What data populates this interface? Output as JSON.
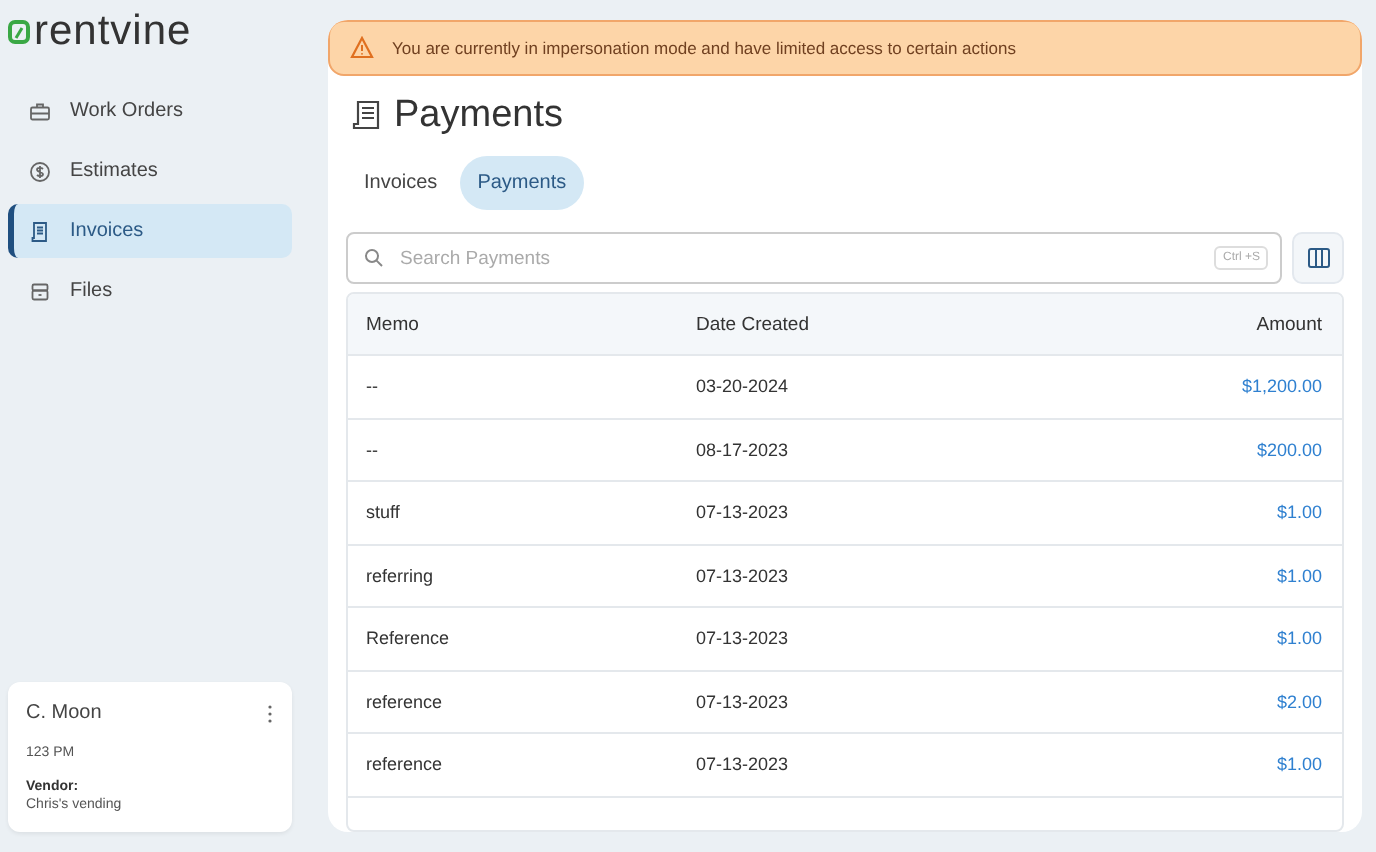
{
  "sidebar": {
    "logo": "rentvine",
    "items": [
      {
        "label": "Work Orders",
        "selected": false
      },
      {
        "label": "Estimates",
        "selected": false
      },
      {
        "label": "Invoices",
        "selected": true
      },
      {
        "label": "Files",
        "selected": false
      }
    ],
    "user_card": {
      "name": "C. Moon",
      "time": "123 PM",
      "vendor_label": "Vendor:",
      "vendor": "Chris's vending"
    }
  },
  "banner": {
    "text": "You are currently in impersonation mode and have limited access to certain actions"
  },
  "page": {
    "title": "Payments",
    "tabs": [
      {
        "label": "Invoices",
        "selected": false
      },
      {
        "label": "Payments",
        "selected": true
      }
    ],
    "search": {
      "placeholder": "Search Payments",
      "shortcut": "Ctrl +S"
    },
    "table": {
      "columns": [
        "Memo",
        "Date Created",
        "Amount"
      ],
      "rows": [
        [
          "--",
          "03-20-2024",
          "$1,200.00"
        ],
        [
          "--",
          "08-17-2023",
          "$200.00"
        ],
        [
          "stuff",
          "07-13-2023",
          "$1.00"
        ],
        [
          "referring",
          "07-13-2023",
          "$1.00"
        ],
        [
          "Reference",
          "07-13-2023",
          "$1.00"
        ],
        [
          "reference",
          "07-13-2023",
          "$2.00"
        ],
        [
          "reference",
          "07-13-2023",
          "$1.00"
        ]
      ]
    }
  }
}
